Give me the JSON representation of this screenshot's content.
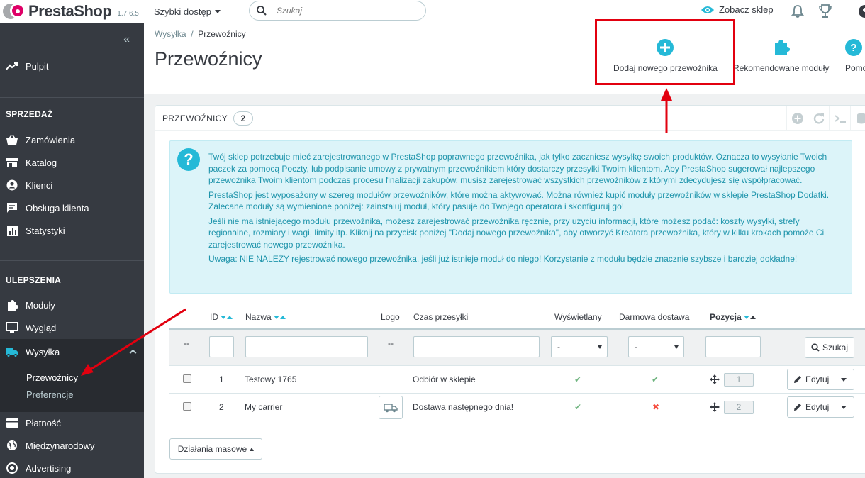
{
  "topbar": {
    "brand": "PrestaShop",
    "version": "1.7.6.5",
    "quick_access": "Szybki dostęp",
    "search_placeholder": "Szukaj",
    "view_shop": "Zobacz sklep"
  },
  "sidebar": {
    "dashboard": "Pulpit",
    "section_sell": "SPRZEDAŻ",
    "sell_items": [
      "Zamówienia",
      "Katalog",
      "Klienci",
      "Obsługa klienta",
      "Statystyki"
    ],
    "section_improve": "ULEPSZENIA",
    "improve_items": [
      "Moduły",
      "Wygląd",
      "Wysyłka"
    ],
    "shipping_sub": [
      "Przewoźnicy",
      "Preferencje"
    ],
    "more_items": [
      "Płatność",
      "Międzynarodowy",
      "Advertising"
    ]
  },
  "header": {
    "breadcrumb_parent": "Wysyłka",
    "breadcrumb_sep": "/",
    "breadcrumb_current": "Przewoźnicy",
    "title": "Przewoźnicy",
    "toolbar": {
      "add_carrier": "Dodaj nowego przewoźnika",
      "recommended_modules": "Rekomendowane moduły",
      "help": "Pomoc"
    }
  },
  "panel": {
    "title": "PRZEWOŹNICY",
    "count": "2",
    "alert": [
      "Twój sklep potrzebuje mieć zarejestrowanego w PrestaShop poprawnego przewoźnika, jak tylko zaczniesz wysyłkę swoich produktów. Oznacza to wysyłanie Twoich paczek za pomocą Poczty, lub podpisanie umowy z prywatnym przewoźnikiem który dostarczy przesyłki Twoim klientom. Aby PrestaShop sugerował najlepszego przewoźnika Twoim klientom podczas procesu finalizacji zakupów, musisz zarejestrować wszystkich przewoźników z którymi zdecydujesz się współpracować.",
      "PrestaShop jest wyposażony w szereg modułów przewoźników, które można aktywować. Można również kupić moduły przewoźników w sklepie PrestaShop Dodatki. Zalecane moduły są wymienione poniżej: zainstaluj moduł, który pasuje do Twojego operatora i skonfiguruj go!",
      "Jeśli nie ma istniejącego modułu przewoźnika, możesz zarejestrować przewoźnika ręcznie, przy użyciu informacji, które możesz podać: koszty wysyłki, strefy regionalne, rozmiary i wagi, limity itp. Kliknij na przycisk poniżej \"Dodaj nowego przewoźnika\", aby otworzyć Kreatora przewoźnika, który w kilku krokach pomoże Ci zarejestrować nowego przewoźnika.",
      "Uwaga: NIE NALEŻY rejestrować nowego przewoźnika, jeśli już istnieje moduł do niego! Korzystanie z modułu będzie znacznie szybsze i bardziej dokładne!"
    ]
  },
  "table": {
    "columns": {
      "id": "ID",
      "name": "Nazwa",
      "logo": "Logo",
      "delay": "Czas przesyłki",
      "active": "Wyświetlany",
      "free": "Darmowa dostawa",
      "position": "Pozycja"
    },
    "filter": {
      "dash": "--",
      "select_value": "-",
      "search_button": "Szukaj"
    },
    "rows": [
      {
        "id": "1",
        "name": "Testowy 1765",
        "delay": "Odbiór w sklepie",
        "active": "✔",
        "free": "✔",
        "position": "1",
        "edit": "Edytuj"
      },
      {
        "id": "2",
        "name": "My carrier",
        "delay": "Dostawa następnego dnia!",
        "active": "✔",
        "free": "✖",
        "position": "2",
        "edit": "Edytuj"
      }
    ],
    "bulk_actions": "Działania masowe"
  },
  "colors": {
    "accent": "#25b9d7",
    "sidebar_bg": "#363a41",
    "success": "#70b580",
    "danger": "#f54c3e",
    "annotation_red": "#e2000f"
  }
}
